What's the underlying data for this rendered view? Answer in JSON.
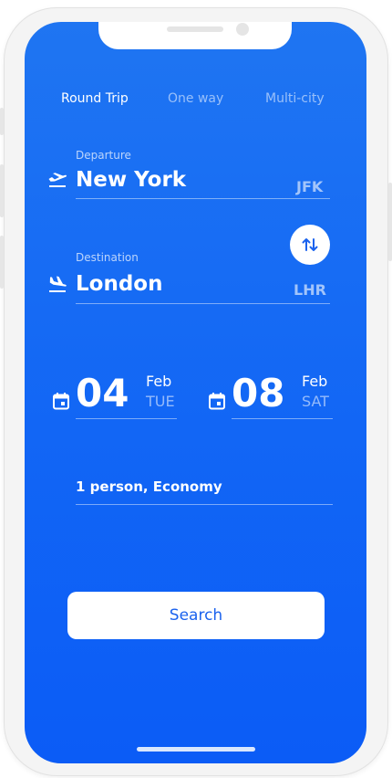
{
  "trip_types": {
    "round_trip": "Round Trip",
    "one_way": "One way",
    "multi_city": "Multi-city"
  },
  "departure": {
    "label": "Departure",
    "city": "New York",
    "code": "JFK",
    "icon": "plane-takeoff-icon"
  },
  "destination": {
    "label": "Destination",
    "city": "London",
    "code": "LHR",
    "icon": "plane-landing-icon"
  },
  "swap": {
    "icon": "swap-vertical-icon"
  },
  "dates": {
    "depart": {
      "day": "04",
      "month": "Feb",
      "weekday": "TUE",
      "icon": "calendar-icon"
    },
    "return": {
      "day": "08",
      "month": "Feb",
      "weekday": "SAT",
      "icon": "calendar-icon"
    }
  },
  "passengers": {
    "summary": "1 person, Economy"
  },
  "search": {
    "label": "Search"
  },
  "colors": {
    "background_top": "#1f75f2",
    "background_bottom": "#0b5cf6",
    "button_text": "#1a62ee"
  }
}
